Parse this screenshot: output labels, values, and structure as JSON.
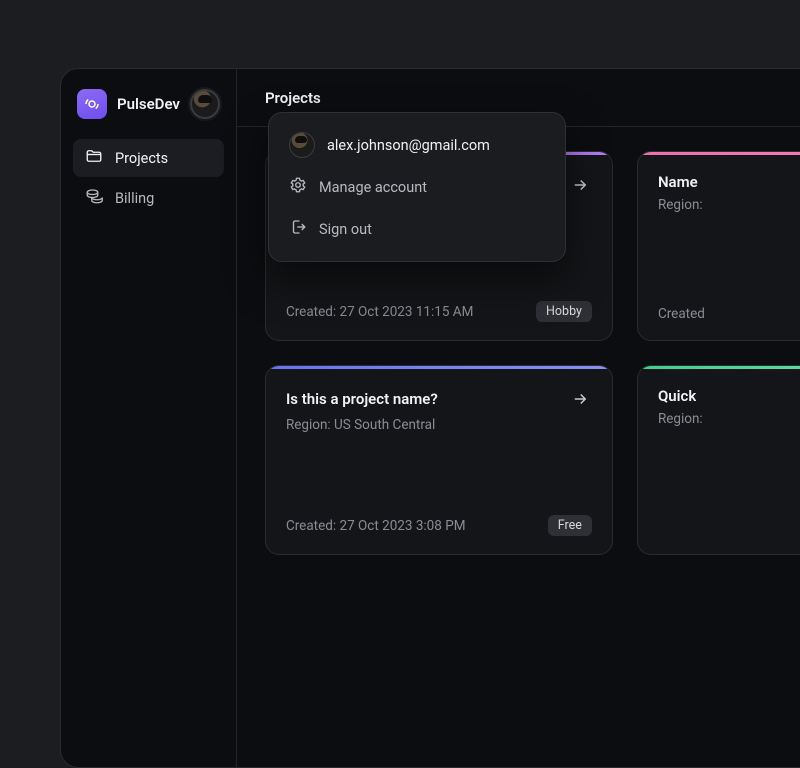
{
  "brand": {
    "name": "PulseDev"
  },
  "sidebar": {
    "items": [
      {
        "label": "Projects"
      },
      {
        "label": "Billing"
      }
    ]
  },
  "header": {
    "title": "Projects"
  },
  "account_menu": {
    "email": "alex.johnson@gmail.com",
    "manage_label": "Manage account",
    "signout_label": "Sign out"
  },
  "projects": [
    {
      "name": "",
      "region_label": "",
      "created_label": "Created: 27 Oct 2023 11:15 AM",
      "plan_label": "Hobby",
      "accent": "purple"
    },
    {
      "name": "Name",
      "region_label": "Region:",
      "created_label": "Created",
      "plan_label": "",
      "accent": "pink"
    },
    {
      "name": "Is this a project name?",
      "region_label": "Region: US South Central",
      "created_label": "Created: 27 Oct 2023 3:08 PM",
      "plan_label": "Free",
      "accent": "indigo"
    },
    {
      "name": "Quick",
      "region_label": "Region:",
      "created_label": "",
      "plan_label": "",
      "accent": "green"
    }
  ]
}
